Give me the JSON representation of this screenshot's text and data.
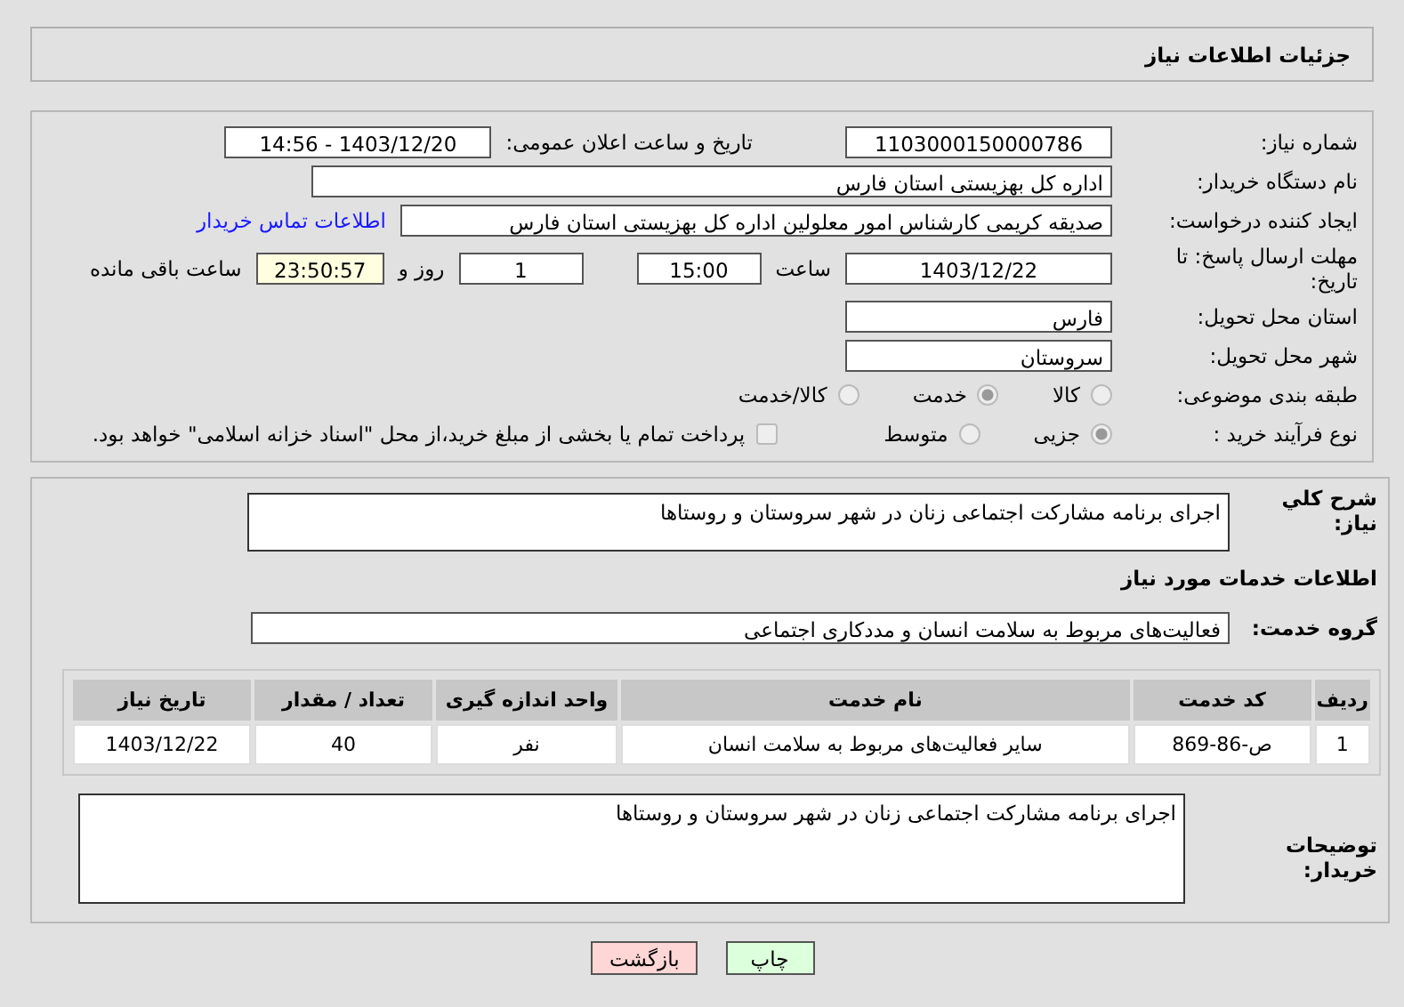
{
  "header": {
    "title": "جزئیات اطلاعات نیاز"
  },
  "details": {
    "need_number": {
      "label": "شماره نیاز:",
      "value": "1103000150000786"
    },
    "announce": {
      "label": "تاریخ و ساعت اعلان عمومی:",
      "value": "1403/12/20 - 14:56"
    },
    "buyer_org": {
      "label": "نام دستگاه خریدار:",
      "value": "اداره کل بهزیستی استان فارس"
    },
    "requester": {
      "label": "ایجاد کننده درخواست:",
      "value": "صدیقه کریمی کارشناس امور معلولین اداره کل بهزیستی استان فارس",
      "link": "اطلاعات تماس خریدار"
    },
    "deadline": {
      "label": "مهلت ارسال پاسخ: تا تاریخ:",
      "date": "1403/12/22",
      "time_label": "ساعت",
      "time": "15:00",
      "days": "1",
      "days_label": "روز و",
      "remaining": "23:50:57",
      "remaining_label": "ساعت باقی مانده"
    },
    "province": {
      "label": "استان محل تحویل:",
      "value": "فارس"
    },
    "city": {
      "label": "شهر محل تحویل:",
      "value": "سروستان"
    },
    "category": {
      "label": "طبقه بندی موضوعی:",
      "options": [
        {
          "label": "کالا",
          "selected": false
        },
        {
          "label": "خدمت",
          "selected": true
        },
        {
          "label": "کالا/خدمت",
          "selected": false
        }
      ]
    },
    "process": {
      "label": "نوع فرآیند خرید :",
      "options": [
        {
          "label": "جزیی",
          "selected": true
        },
        {
          "label": "متوسط",
          "selected": false
        }
      ],
      "payment": {
        "label": "پرداخت تمام یا بخشی از مبلغ خرید،از محل \"اسناد خزانه اسلامی\" خواهد بود.",
        "checked": false
      }
    }
  },
  "services": {
    "summary": {
      "label": "شرح کلي نياز:",
      "value": "اجرای برنامه مشارکت اجتماعی زنان در شهر سروستان و روستاها"
    },
    "heading": "اطلاعات خدمات مورد نیاز",
    "group": {
      "label": "گروه خدمت:",
      "value": "فعالیت‌های مربوط به سلامت انسان و مددکاری اجتماعی"
    },
    "table": {
      "columns": [
        "ردیف",
        "کد خدمت",
        "نام خدمت",
        "واحد اندازه گیری",
        "تعداد / مقدار",
        "تاریخ نیاز"
      ],
      "rows": [
        [
          "1",
          "ص-86-869",
          "سایر فعالیت‌های مربوط به سلامت انسان",
          "نفر",
          "40",
          "1403/12/22"
        ]
      ]
    },
    "buyer_notes": {
      "label": "توضیحات خریدار:",
      "value": "اجرای برنامه مشارکت اجتماعی زنان در شهر سروستان و روستاها"
    }
  },
  "buttons": [
    {
      "label": "چاپ",
      "kind": "print"
    },
    {
      "label": "بازگشت",
      "kind": "back"
    }
  ]
}
